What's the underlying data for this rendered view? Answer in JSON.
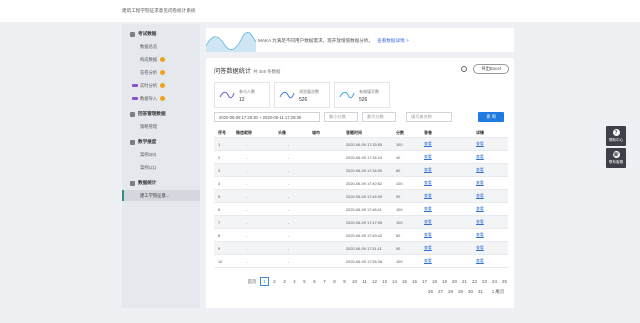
{
  "header": {
    "title": "建筑工程学院征求意见问卷统计系统"
  },
  "sidebar": {
    "groups": [
      {
        "label": "考试数据",
        "items": [
          {
            "label": "数据总览",
            "gold": false,
            "vip": false
          },
          {
            "label": "构成数据",
            "gold": true,
            "vip": false
          },
          {
            "label": "答卷分析",
            "gold": true,
            "vip": false
          },
          {
            "label": "实时分析",
            "gold": true,
            "vip": true
          },
          {
            "label": "数据导入",
            "gold": true,
            "vip": true
          }
        ]
      },
      {
        "label": "回答管理数据",
        "items": [
          {
            "label": "策略管理",
            "gold": false,
            "vip": false
          }
        ]
      },
      {
        "label": "数学维度",
        "items": [
          {
            "label": "案例2(0)",
            "gold": false,
            "vip": false
          },
          {
            "label": "案例1(1)",
            "gold": false,
            "vip": false
          }
        ]
      },
      {
        "label": "数据统计",
        "items": [
          {
            "label": "建工学院征意...",
            "gold": false,
            "vip": false
          }
        ]
      }
    ]
  },
  "banner": {
    "text": "MAKA 为满足不同用户数据需求，现开放增值数据分析。",
    "link": "查看数据详情 >"
  },
  "panel": {
    "title": "问答数据统计",
    "count": "共 358 条数据",
    "export_label": "导出Excel"
  },
  "stats": [
    {
      "label": "参与人数",
      "value": "12"
    },
    {
      "label": "浏览量次数",
      "value": "526"
    },
    {
      "label": "有效填写数",
      "value": "526"
    }
  ],
  "filters": {
    "date_range": "2020-06-09 17:29:30  ~  2020-06-11 17:29:30",
    "score_placeholder": "最小分数",
    "score_max_placeholder": "最大分数",
    "name_placeholder": "填写者名称",
    "search_label": "查 询"
  },
  "table": {
    "headers": [
      "序号",
      "微信昵称",
      "头像",
      "城市",
      "答题时间",
      "分数",
      "答卷",
      "详情"
    ],
    "rows": [
      [
        "1",
        "-",
        "-",
        "",
        "2020-06-09 17:33:55",
        "100",
        "查看",
        "查看"
      ],
      [
        "2",
        "-",
        "-",
        "",
        "2020-06-09 17:34:10",
        "40",
        "查看",
        "查看"
      ],
      [
        "3",
        "-",
        "-",
        "",
        "2020-06-09 17:34:30",
        "60",
        "查看",
        "查看"
      ],
      [
        "4",
        "-",
        "-",
        "",
        "2020-06-09 17:40:52",
        "100",
        "查看",
        "查看"
      ],
      [
        "5",
        "-",
        "-",
        "",
        "2020-06-09 17:44:09",
        "90",
        "查看",
        "查看"
      ],
      [
        "6",
        "-",
        "-",
        "",
        "2020-06-09 17:46:11",
        "100",
        "查看",
        "查看"
      ],
      [
        "7",
        "-",
        "-",
        "",
        "2020-06-09 17:47:05",
        "100",
        "查看",
        "查看"
      ],
      [
        "8",
        "-",
        "-",
        "",
        "2020-06-09 17:49:42",
        "50",
        "查看",
        "查看"
      ],
      [
        "9",
        "-",
        "-",
        "",
        "2020-06-09 17:51:11",
        "90",
        "查看",
        "查看"
      ],
      [
        "10",
        "-",
        "-",
        "",
        "2020-06-09 17:55:38",
        "100",
        "查看",
        "查看"
      ]
    ]
  },
  "pagination": {
    "prev_label": "首页",
    "next_label": "下一页",
    "row1": [
      "1",
      "2",
      "3",
      "4",
      "5",
      "6",
      "7",
      "8",
      "9",
      "10",
      "11",
      "12",
      "13",
      "14",
      "15",
      "16",
      "17",
      "18",
      "19",
      "20",
      "21",
      "22",
      "23",
      "24",
      "25"
    ],
    "row2": [
      "26",
      "27",
      "28",
      "29",
      "30",
      "31"
    ],
    "current": "1",
    "last_label": "1 尾页"
  },
  "floats": [
    {
      "label": "帮助中心",
      "glyph": "?"
    },
    {
      "label": "联系客服",
      "glyph": "☏"
    }
  ]
}
